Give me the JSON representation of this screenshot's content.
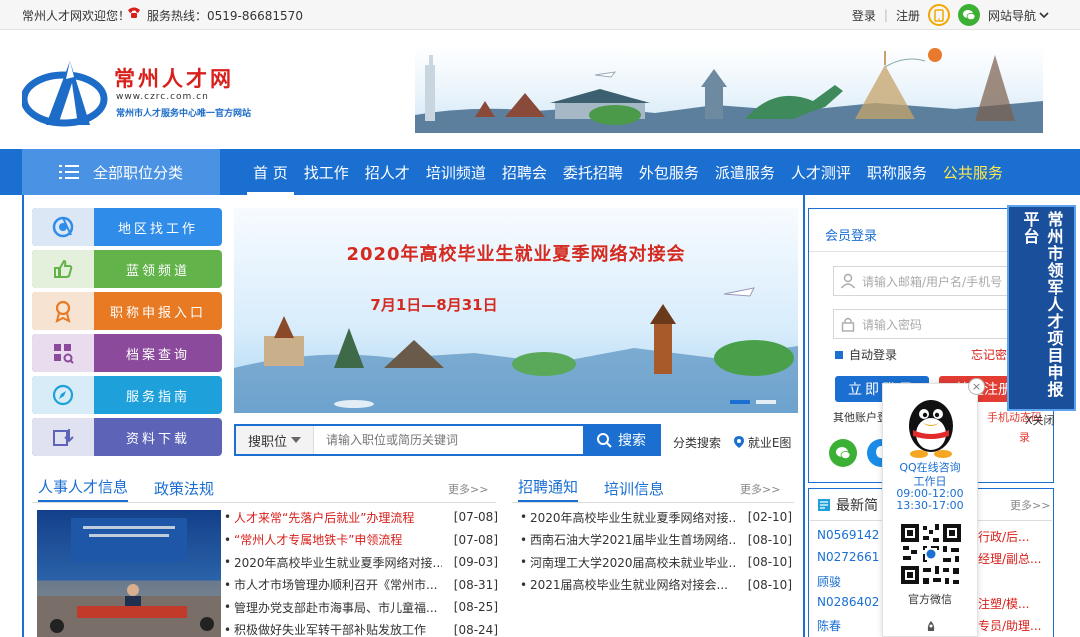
{
  "topbar": {
    "welcome": "常州人才网欢迎您！",
    "hotline": "服务热线：0519-86681570",
    "login": "登录",
    "register": "注册",
    "site_nav": "网站导航"
  },
  "header": {
    "brand": "常州人才网",
    "url": "www.czrc.com.cn",
    "slogan": "常州市人才服务中心唯一官方网站"
  },
  "nav": {
    "all_categories": "全部职位分类",
    "items": [
      "首 页",
      "找工作",
      "招人才",
      "培训频道",
      "招聘会",
      "委托招聘",
      "外包服务",
      "派遣服务",
      "人才测评",
      "职称服务",
      "公共服务"
    ]
  },
  "quick_links": [
    {
      "label": "地区找工作",
      "color": "#2f8ce8",
      "icon": "globe-icon"
    },
    {
      "label": "蓝领频道",
      "color": "#62b34a",
      "icon": "thumbs-up-icon"
    },
    {
      "label": "职称申报入口",
      "color": "#e77a23",
      "icon": "medal-icon"
    },
    {
      "label": "档案查询",
      "color": "#8c4a9c",
      "icon": "qr-search-icon"
    },
    {
      "label": "服务指南",
      "color": "#1ea0db",
      "icon": "compass-icon"
    },
    {
      "label": "资料下载",
      "color": "#5d64b8",
      "icon": "download-icon"
    }
  ],
  "banner": {
    "title": "2020年高校毕业生就业夏季网络对接会",
    "date": "7月1日—8月31日"
  },
  "search": {
    "type": "搜职位",
    "placeholder": "请输入职位或简历关键词",
    "button": "搜索",
    "category_search": "分类搜索",
    "map": "就业E图"
  },
  "left_news": {
    "tabs": [
      "人事人才信息",
      "政策法规"
    ],
    "more": "更多>>",
    "items": [
      {
        "title": "人才来常“先落户后就业”办理流程",
        "date": "[07-08]",
        "red": true
      },
      {
        "title": "“常州人才专属地铁卡”申领流程",
        "date": "[07-08]",
        "red": true
      },
      {
        "title": "2020年高校毕业生就业夏季网络对接...",
        "date": "[09-03]",
        "red": false
      },
      {
        "title": "市人才市场管理办顺利召开《常州市...",
        "date": "[08-31]",
        "red": false
      },
      {
        "title": "管理办党支部赴市海事局、市儿童福...",
        "date": "[08-25]",
        "red": false
      },
      {
        "title": "积极做好失业军转干部补贴发放工作",
        "date": "[08-24]",
        "red": false
      }
    ]
  },
  "right_news": {
    "tabs": [
      "招聘通知",
      "培训信息"
    ],
    "more": "更多>>",
    "items": [
      {
        "title": "2020年高校毕业生就业夏季网络对接...",
        "date": "[02-10]"
      },
      {
        "title": "西南石油大学2021届毕业生首场网络...",
        "date": "[08-10]"
      },
      {
        "title": "河南理工大学2020届高校未就业毕业...",
        "date": "[08-10]"
      },
      {
        "title": "2021届高校毕业生就业网络对接会...",
        "date": "[08-10]"
      }
    ]
  },
  "login": {
    "title": "会员登录",
    "username_placeholder": "请输入邮箱/用户名/手机号",
    "password_placeholder": "请输入密码",
    "auto_login": "自动登录",
    "forgot": "忘记密",
    "login_button": "立即登录",
    "register_button": "快速注册",
    "other_accounts": "其他账户登",
    "sms_login": "手机动态码",
    "sms_login_2": "录"
  },
  "brief": {
    "title": "最新简",
    "more": "更多>>",
    "codes": [
      "N0569142",
      "N0272661",
      "顾骏",
      "N0286402",
      "陈春"
    ],
    "right_texts": [
      "行政/后...",
      "经理/副总...",
      "",
      "注塑/模...",
      "专员/助理..."
    ]
  },
  "qq_float": {
    "title": "QQ在线咨询",
    "day": "工作日",
    "time1": "09:00-12:00",
    "time2": "13:30-17:00",
    "wechat": "官方微信",
    "close": "×"
  },
  "vertical_banner": {
    "text": "常州市领军人才项目申报平台",
    "close": "X关闭"
  }
}
